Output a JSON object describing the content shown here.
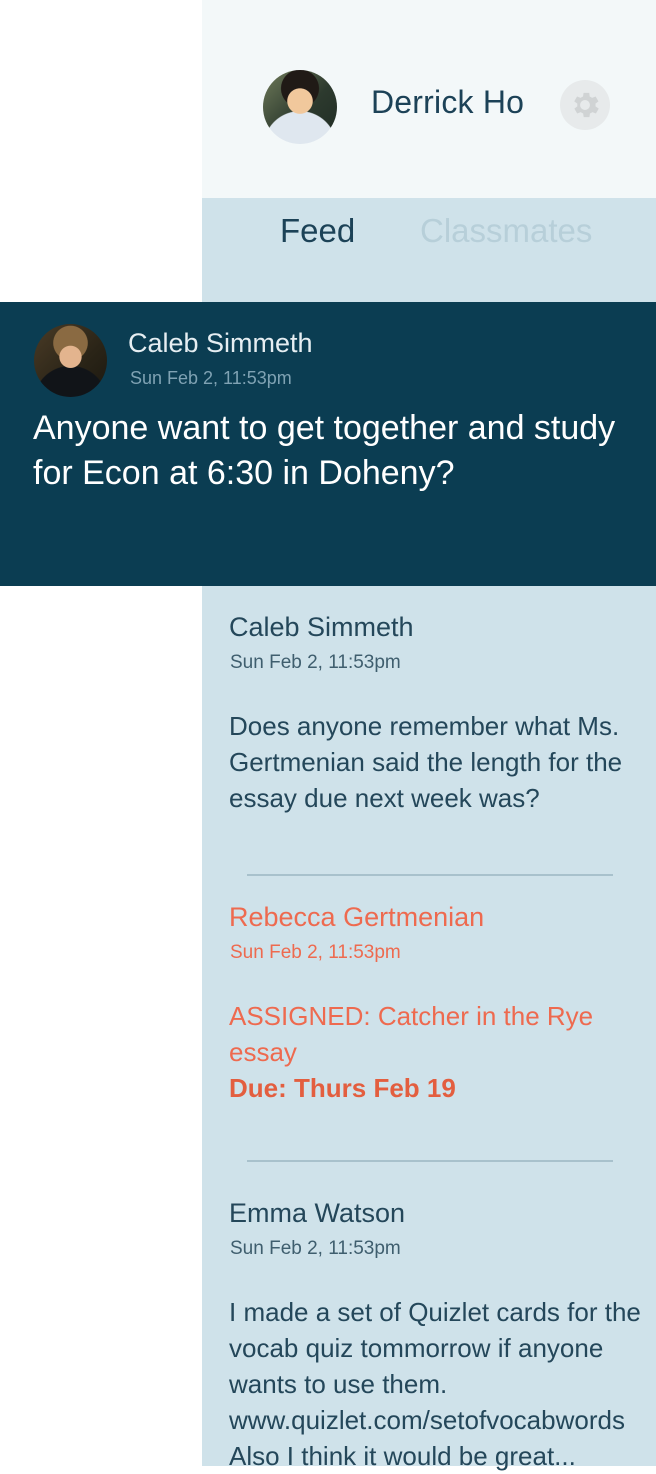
{
  "profile": {
    "name": "Derrick Ho",
    "avatar_icon": "person-avatar",
    "settings_icon": "gear-icon"
  },
  "tabs": [
    {
      "label": "Feed",
      "active": true
    },
    {
      "label": "Classmates",
      "active": false
    }
  ],
  "featured_post": {
    "author": "Caleb Simmeth",
    "time": "Sun Feb 2, 11:53pm",
    "body": "Anyone want to get together and study for Econ at 6:30 in Doheny?"
  },
  "posts": [
    {
      "author": "Caleb Simmeth",
      "time": "Sun Feb 2, 11:53pm",
      "body": "Does anyone remember what Ms. Gertmenian said the length for the essay due next week was?"
    },
    {
      "author": "Rebecca Gertmenian",
      "time": "Sun Feb 2, 11:53pm",
      "body": "ASSIGNED: Catcher in the Rye essay",
      "due": "Due: Thurs Feb 19",
      "accent": "#ee6a4f"
    },
    {
      "author": "Emma Watson",
      "time": "Sun Feb 2, 11:53pm",
      "body": "I made a set of Quizlet cards for the vocab quiz tommorrow if anyone wants to use them. www.quizlet.com/setofvocabwords Also I think it would be great..."
    }
  ],
  "colors": {
    "header_bg": "#f3f8f9",
    "panel_bg": "#cfe2ea",
    "featured_bg": "#0b3d52",
    "teacher_accent": "#ee6a4f"
  }
}
